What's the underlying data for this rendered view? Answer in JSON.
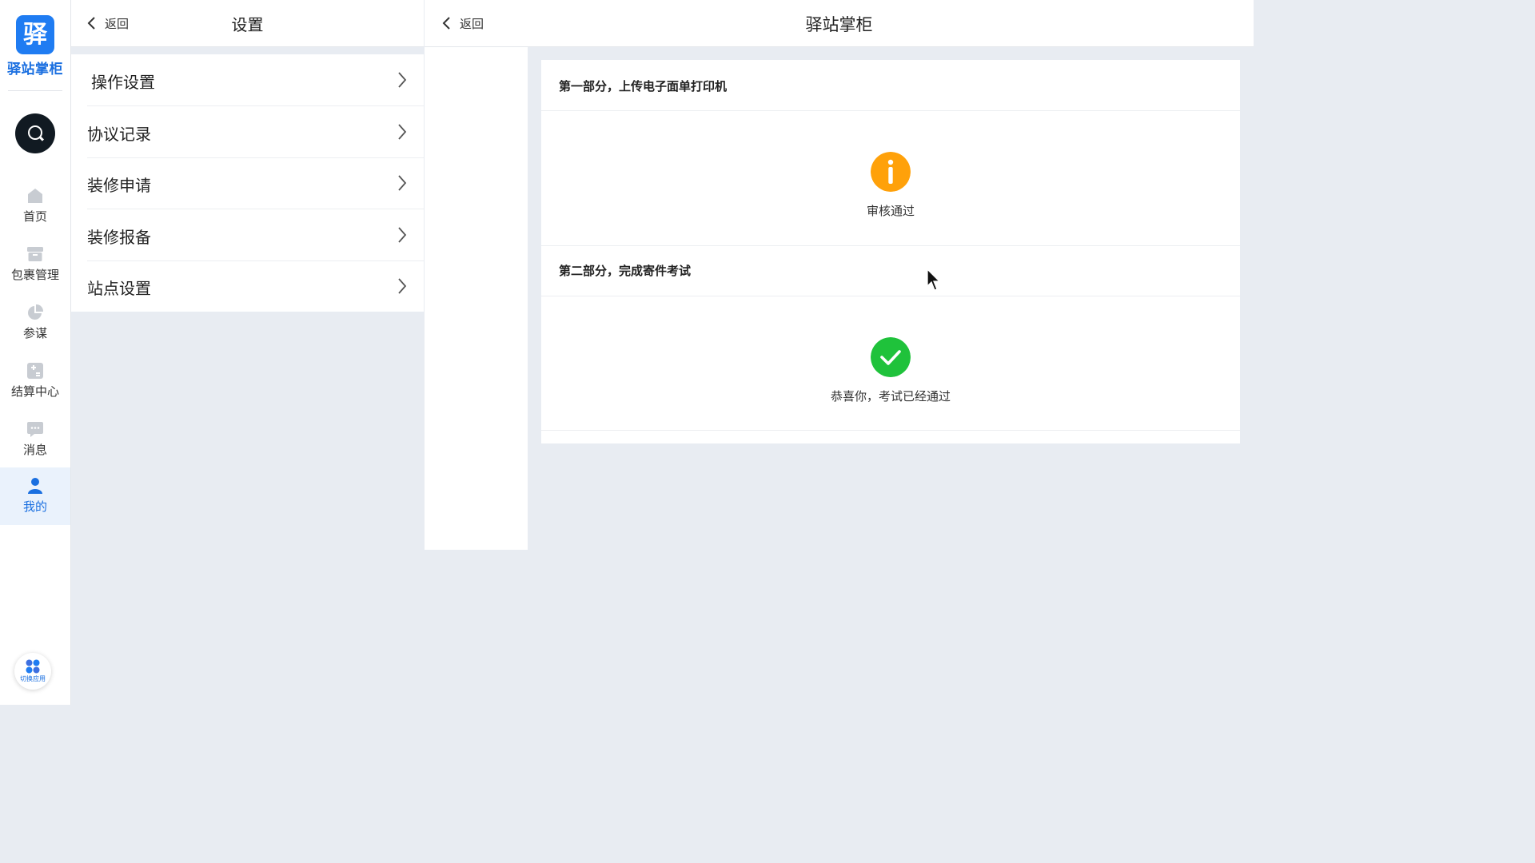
{
  "nav": {
    "logo_char": "驿",
    "logo_text": "驿站掌柜",
    "items": [
      {
        "label": "首页",
        "icon": "home-icon"
      },
      {
        "label": "包裹管理",
        "icon": "package-icon"
      },
      {
        "label": "参谋",
        "icon": "pie-chart-icon"
      },
      {
        "label": "结算中心",
        "icon": "settlement-icon"
      },
      {
        "label": "消息",
        "icon": "message-icon"
      },
      {
        "label": "我的",
        "icon": "user-icon",
        "active": true
      }
    ],
    "switch_app_label": "切换应用",
    "accent_color": "#1f7cf2"
  },
  "settings": {
    "back_label": "返回",
    "title": "设置",
    "menu": [
      {
        "label": "操作设置"
      },
      {
        "label": "协议记录"
      },
      {
        "label": "装修申请"
      },
      {
        "label": "装修报备"
      },
      {
        "label": "站点设置"
      }
    ]
  },
  "content": {
    "back_label": "返回",
    "title": "驿站掌柜",
    "sections": [
      {
        "title": "第一部分，上传电子面单打印机",
        "status_text": "审核通过",
        "status_icon": "info-icon",
        "status_color": "#ffa10a"
      },
      {
        "title": "第二部分，完成寄件考试",
        "status_text": "恭喜你，考试已经通过",
        "status_icon": "check-icon",
        "status_color": "#1fc23b"
      }
    ]
  }
}
